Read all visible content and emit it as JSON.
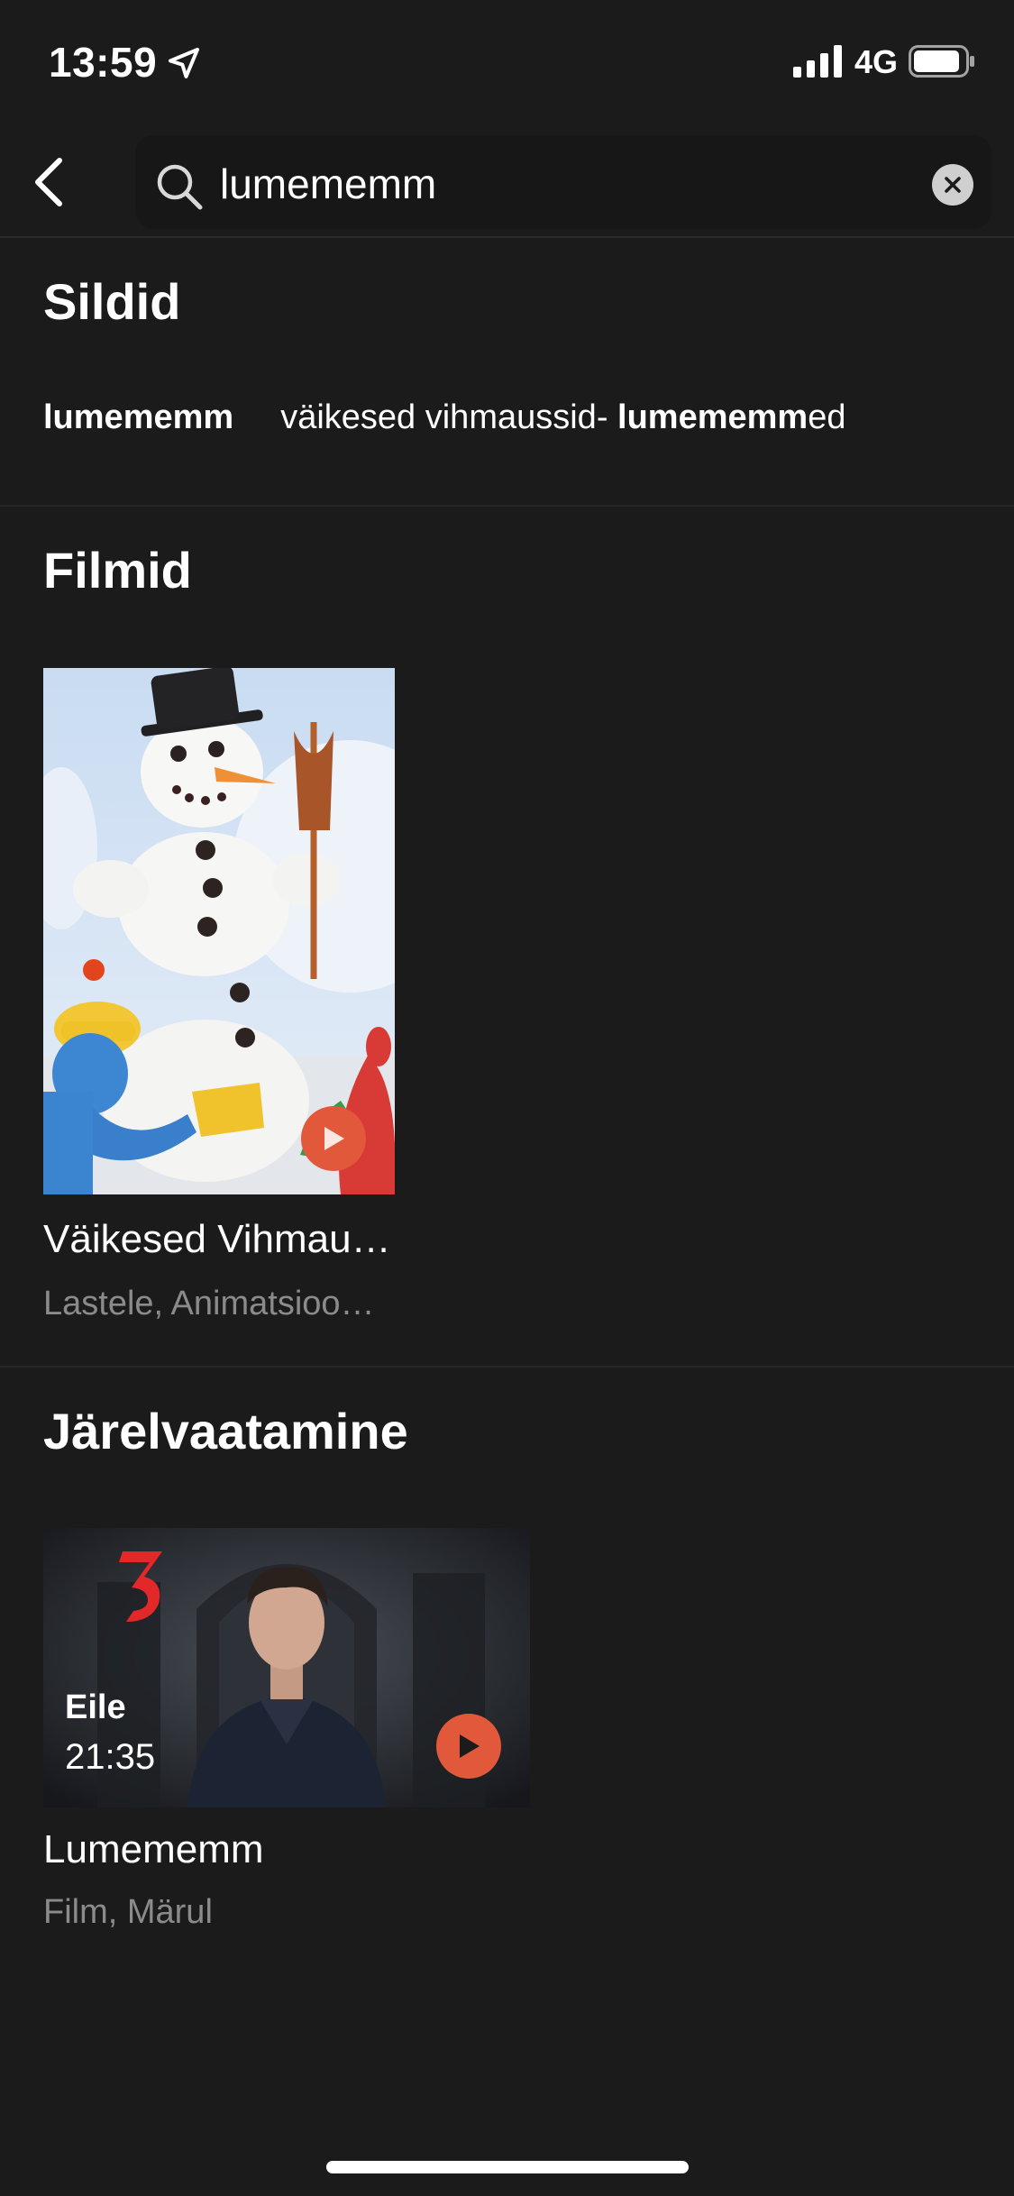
{
  "status": {
    "time": "13:59",
    "network": "4G"
  },
  "search": {
    "query": "lumememm"
  },
  "sections": {
    "tags": {
      "title": "Sildid",
      "items": [
        {
          "bold": "lumememm",
          "pre": "",
          "post": ""
        },
        {
          "pre": "väikesed vihmaussid- ",
          "bold": "lumememm",
          "post": "ed"
        }
      ]
    },
    "films": {
      "title": "Filmid",
      "items": [
        {
          "title": "Väikesed Vihmau…",
          "subtitle": "Lastele, Animatsioo…"
        }
      ]
    },
    "replay": {
      "title": "Järelvaatamine",
      "items": [
        {
          "badge_day": "Eile",
          "badge_time": "21:35",
          "title": "Lumememm",
          "subtitle": "Film, Märul"
        }
      ]
    }
  },
  "colors": {
    "background": "#1b1b1c",
    "accent": "#e2583b",
    "muted_text": "#8b8b8b"
  }
}
